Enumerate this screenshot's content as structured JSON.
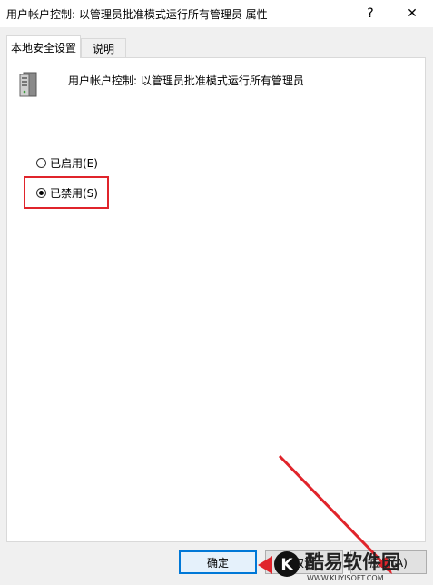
{
  "window": {
    "title": "用户帐户控制: 以管理员批准模式运行所有管理员 属性",
    "help_label": "?",
    "close_label": "✕"
  },
  "tabs": [
    {
      "label": "本地安全设置",
      "active": true
    },
    {
      "label": "说明",
      "active": false
    }
  ],
  "policy": {
    "icon": "server-icon",
    "title": "用户帐户控制: 以管理员批准模式运行所有管理员"
  },
  "options": {
    "enabled_label": "已启用(E)",
    "disabled_label": "已禁用(S)",
    "selected": "disabled"
  },
  "buttons": {
    "ok_label": "确定",
    "cancel_label": "取消",
    "apply_label": "应用(A)"
  },
  "annotation": {
    "highlight_color": "#e0242b",
    "arrow_color": "#e0242b"
  },
  "watermark": {
    "logo_letter": "K",
    "brand_text": "酷易软件园",
    "brand_url": "WWW.KUYISOFT.COM"
  },
  "colors": {
    "accent": "#0078d7",
    "panel_bg": "#ffffff",
    "window_bg": "#f0f0f0"
  }
}
